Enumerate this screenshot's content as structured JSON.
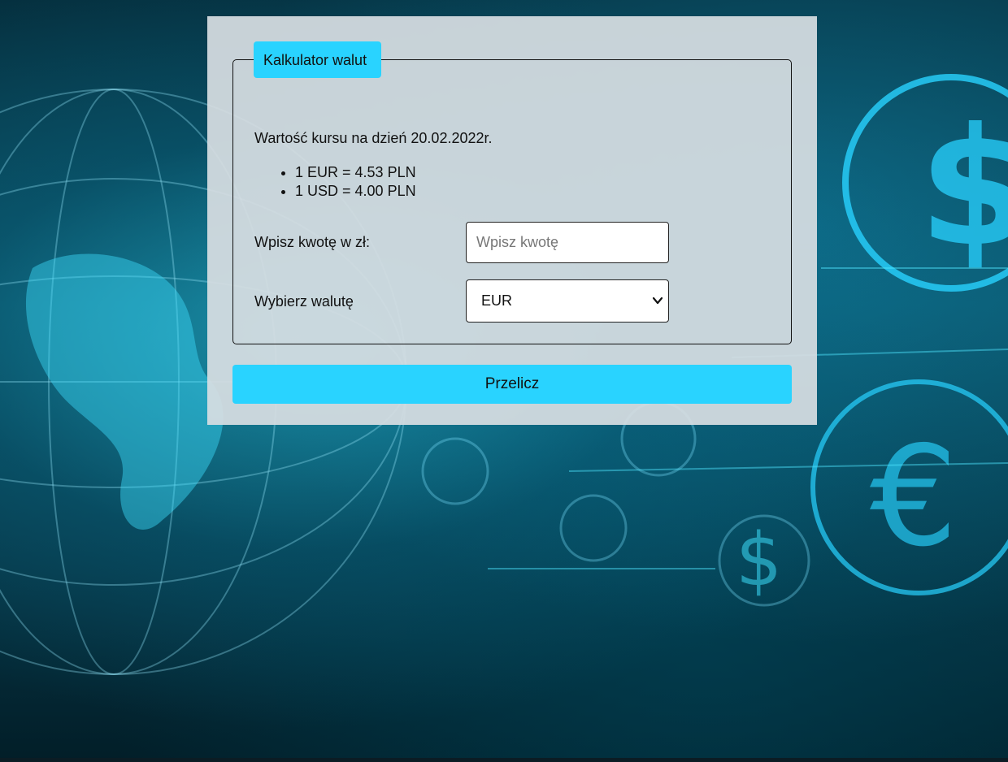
{
  "calculator": {
    "legend": "Kalkulator walut",
    "rate_date_text": "Wartość kursu na dzień 20.02.2022r.",
    "rates": [
      "1 EUR = 4.53 PLN",
      "1 USD = 4.00 PLN"
    ],
    "amount": {
      "label": "Wpisz kwotę w zł:",
      "value": "",
      "placeholder": "Wpisz kwotę"
    },
    "currency": {
      "label": "Wybierz walutę",
      "selected": "EUR"
    },
    "convert_button_label": "Przelicz"
  },
  "colors": {
    "accent": "#29d3ff",
    "panel": "#d7dee2",
    "background": "#0a4d61"
  },
  "icons": {
    "select_arrow": "chevron-down-icon",
    "background_symbols": [
      "dollar-icon",
      "euro-icon",
      "yen-icon",
      "bitcoin-icon",
      "globe-icon"
    ]
  }
}
